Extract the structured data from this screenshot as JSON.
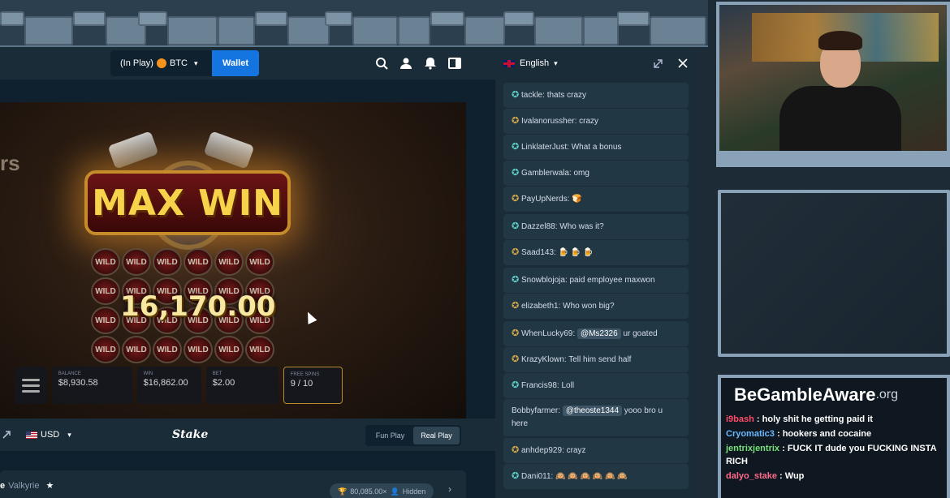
{
  "topbar": {
    "balance_label": "(In Play)",
    "currency": "BTC",
    "wallet_label": "Wallet"
  },
  "game": {
    "banner_text": "MAX WIN",
    "win_amount": "16,170.00",
    "cell_label": "WILD",
    "side_logo": "rs",
    "bar": {
      "balance_label": "BALANCE",
      "balance_value": "$8,930.58",
      "win_label": "WIN",
      "win_value": "$16,862.00",
      "bet_label": "BET",
      "bet_value": "$2.00",
      "freespins_label": "FREE SPINS",
      "freespins_value": "9 / 10"
    }
  },
  "footer": {
    "currency": "USD",
    "logo": "Stake",
    "fun_play": "Fun Play",
    "real_play": "Real Play"
  },
  "below": {
    "game_name_suffix": "e",
    "provider": "Valkyrie",
    "multiplier": "80,085.00×",
    "hidden_label": "Hidden"
  },
  "chat": {
    "language": "English",
    "messages": [
      {
        "user": "tackle",
        "text": "thats crazy",
        "rank": "teal"
      },
      {
        "user": "Ivalanorussher",
        "text": "crazy",
        "rank": "gold"
      },
      {
        "user": "LinklaterJust",
        "text": "What a bonus",
        "rank": "teal"
      },
      {
        "user": "Gamblerwala",
        "text": "omg",
        "rank": "teal"
      },
      {
        "user": "PayUpNerds",
        "text": "🍞",
        "rank": "gold"
      },
      {
        "user": "Dazzel88",
        "text": "Who was it?",
        "rank": "teal"
      },
      {
        "user": "Saad143",
        "text": "🍺 🍺 🍺",
        "rank": "gold"
      },
      {
        "user": "Snowblojoja",
        "text": "paid employee maxwon",
        "rank": "teal"
      },
      {
        "user": "elizabeth1",
        "text": "Who won big?",
        "rank": "gold"
      },
      {
        "user": "WhenLucky69",
        "mention": "@Ms2326",
        "text": "ur goated",
        "rank": "gold"
      },
      {
        "user": "KrazyKlown",
        "text": "Tell him send half",
        "rank": "gold"
      },
      {
        "user": "Francis98",
        "text": "Loll",
        "rank": "teal"
      },
      {
        "user": "Bobbyfarmer",
        "mention": "@theoste1344",
        "text": "yooo bro u here",
        "rank": "none"
      },
      {
        "user": "anhdep929",
        "text": "crayz",
        "rank": "gold"
      },
      {
        "user": "Dani011",
        "text": "🙉 🙉 🙉 🙉 🙉 🙉",
        "rank": "teal"
      }
    ]
  },
  "stream_chat": {
    "brand": "BeGambleAware",
    "brand_suffix": ".org",
    "lines": [
      {
        "user": "i9bash",
        "text": ": holy shit he getting paid it"
      },
      {
        "user": "Cryomatic3",
        "text": ": hookers and cocaine"
      },
      {
        "user": "jentrixjentrix",
        "text": ": FUCK IT dude you FUCKING INSTA RICH"
      },
      {
        "user": "dalyo_stake",
        "text": ": Wup"
      }
    ]
  },
  "colors": {
    "stake_bg": "#0f212e",
    "panel": "#1a2c38",
    "wallet_blue": "#1475e1",
    "chat_msg": "#213743",
    "frame": "#8aa2b8"
  }
}
